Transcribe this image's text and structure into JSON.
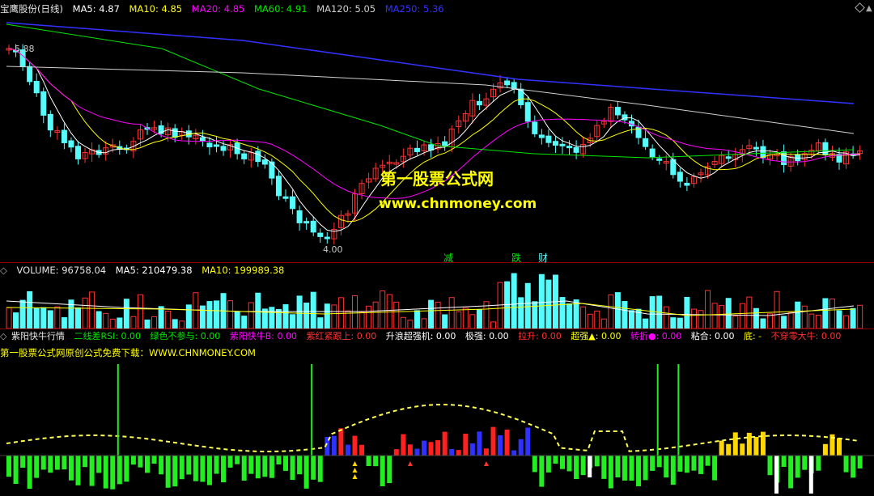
{
  "price_header": {
    "title": "宝鹰股份(日线)",
    "ma5": "MA5: 4.87",
    "ma10": "MA10: 4.85",
    "ma20": "MA20: 4.85",
    "ma60": "MA60: 4.91",
    "ma120": "MA120: 5.05",
    "ma250": "MA250: 5.36"
  },
  "high_label": "5.88",
  "low_label": "4.00",
  "watermark": {
    "line1": "第一股票公式网",
    "line2": "www.chnmoney.com"
  },
  "events": {
    "e1": "减",
    "e2": "跌",
    "e3": "财"
  },
  "vol_header": {
    "vol": "VOLUME: 96758.04",
    "ma5": "MA5: 210479.38",
    "ma10": "MA10: 199989.38"
  },
  "ind_header": {
    "name": "紫阳快牛行情",
    "i1": "二线差RSI: 0.00",
    "i2": "绿色不参与: 0.00",
    "i3": "紫阳快牛B: 0.00",
    "i4": "紫红紧跟上: 0.00",
    "i5": "升浪超强机: 0.00",
    "i6": "极强: 0.00",
    "i7": "拉升: 0.00",
    "i8": "超强▲: 0.00",
    "i9": "转折●: 0.00",
    "i10": "粘合: 0.00",
    "i11": "底: -",
    "i12": "不穿零大牛: 0.00"
  },
  "ind_note": "第一股票公式网原创公式免费下载：WWW.CHNMONEY.COM",
  "colors": {
    "up": "#ff3232",
    "down": "#54fcfc",
    "ma5": "#ffffff",
    "ma10": "#ffff00",
    "ma20": "#ff00ff",
    "ma60": "#00e600",
    "ma120": "#d0d0d0",
    "ma250": "#3232ff"
  }
}
